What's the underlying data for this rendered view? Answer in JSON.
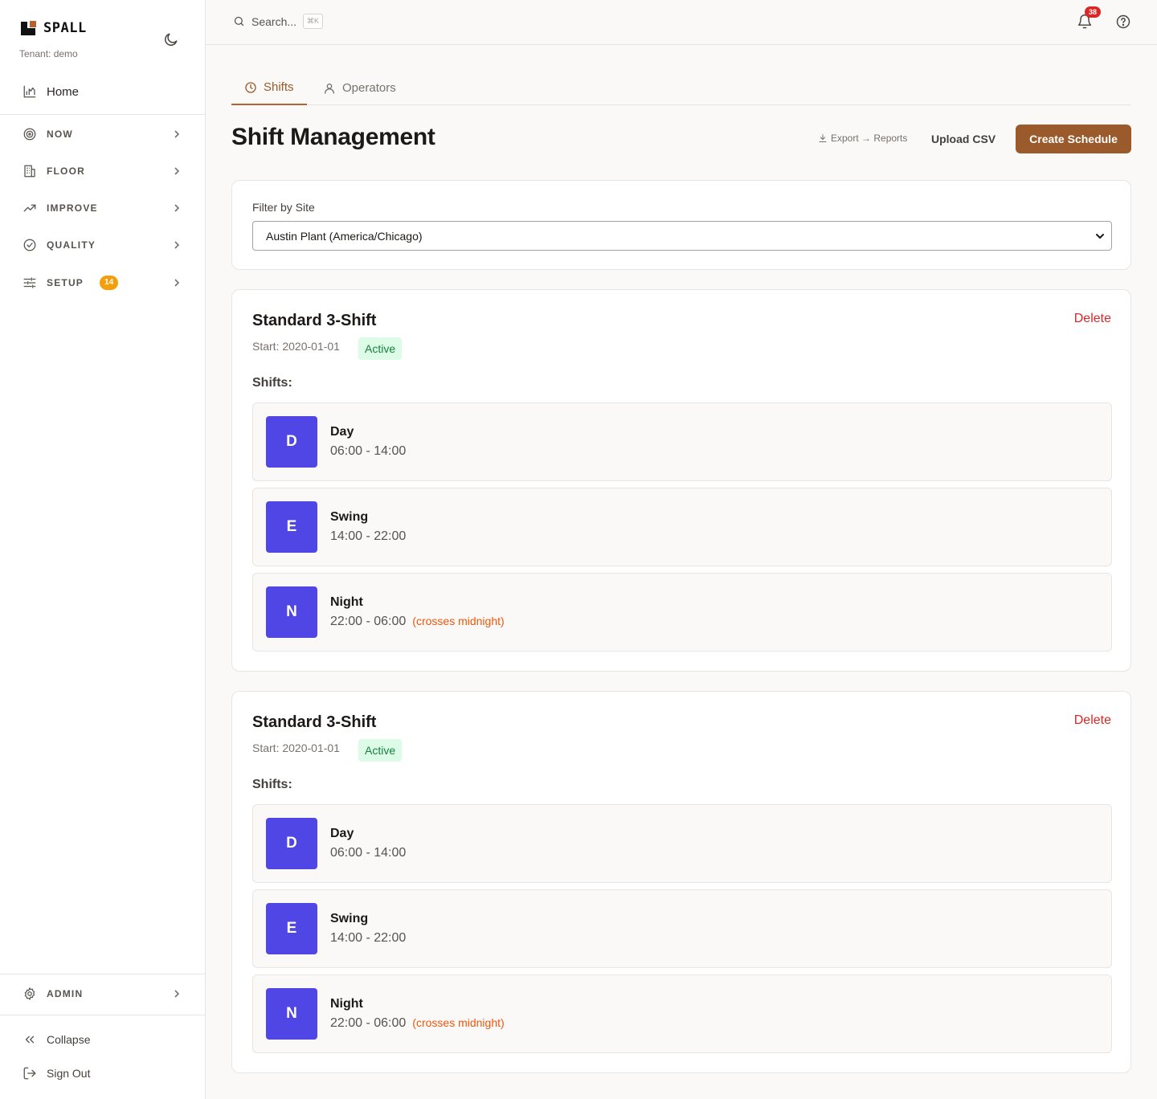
{
  "app": {
    "brand": "SPALL",
    "tenant": "Tenant: demo"
  },
  "sidebar": {
    "home": "Home",
    "sections": [
      {
        "label": "NOW",
        "icon": "target-icon"
      },
      {
        "label": "FLOOR",
        "icon": "building-icon"
      },
      {
        "label": "IMPROVE",
        "icon": "trending-up-icon"
      },
      {
        "label": "QUALITY",
        "icon": "check-circle-icon"
      },
      {
        "label": "SETUP",
        "icon": "sliders-icon",
        "badge": "14"
      }
    ],
    "admin": "ADMIN",
    "collapse": "Collapse",
    "signout": "Sign Out"
  },
  "topbar": {
    "search_placeholder": "Search...",
    "shortcut": "⌘K",
    "notifications": "38"
  },
  "tabs": [
    {
      "label": "Shifts",
      "active": true
    },
    {
      "label": "Operators",
      "active": false
    }
  ],
  "page": {
    "title": "Shift Management",
    "export_link": "Export → Reports",
    "upload_label": "Upload CSV",
    "create_label": "Create Schedule"
  },
  "filter": {
    "label": "Filter by Site",
    "selected": "Austin Plant (America/Chicago)"
  },
  "schedules": [
    {
      "title": "Standard 3-Shift",
      "start": "Start: 2020-01-01",
      "status": "Active",
      "delete_label": "Delete",
      "shifts_label": "Shifts:",
      "shifts": [
        {
          "letter": "D",
          "name": "Day",
          "time": "06:00 - 14:00",
          "note": ""
        },
        {
          "letter": "E",
          "name": "Swing",
          "time": "14:00 - 22:00",
          "note": ""
        },
        {
          "letter": "N",
          "name": "Night",
          "time": "22:00 - 06:00",
          "note": "(crosses midnight)"
        }
      ]
    },
    {
      "title": "Standard 3-Shift",
      "start": "Start: 2020-01-01",
      "status": "Active",
      "delete_label": "Delete",
      "shifts_label": "Shifts:",
      "shifts": [
        {
          "letter": "D",
          "name": "Day",
          "time": "06:00 - 14:00",
          "note": ""
        },
        {
          "letter": "E",
          "name": "Swing",
          "time": "14:00 - 22:00",
          "note": ""
        },
        {
          "letter": "N",
          "name": "Night",
          "time": "22:00 - 06:00",
          "note": "(crosses midnight)"
        }
      ]
    }
  ],
  "colors": {
    "accent": "#9a5a2b",
    "shift_badge": "#4f46e5",
    "danger": "#dc2626",
    "status_bg": "#dcfce7",
    "status_text": "#15803d",
    "note": "#ea580c"
  }
}
